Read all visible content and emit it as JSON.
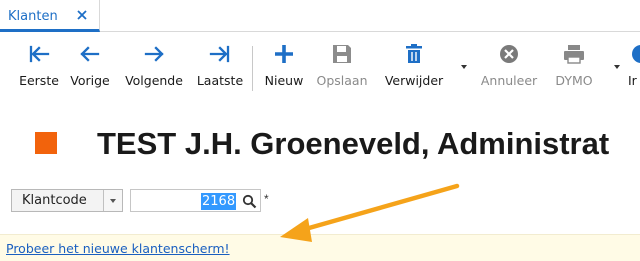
{
  "tab": {
    "label": "Klanten",
    "close_icon": "close-icon"
  },
  "toolbar": {
    "eerste": "Eerste",
    "vorige": "Vorige",
    "volgende": "Volgende",
    "laatste": "Laatste",
    "nieuw": "Nieuw",
    "opslaan": "Opslaan",
    "verwijder": "Verwijder",
    "annuleer": "Annuleer",
    "dymo": "DYMO",
    "partial": "Ir"
  },
  "title": "TEST J.H. Groeneveld, Administrat",
  "search": {
    "field_label": "Klantcode",
    "value": "2168",
    "required_marker": "*"
  },
  "banner": {
    "link_text": "Probeer het nieuwe klantenscherm!"
  },
  "colors": {
    "accent": "#1e6fc6",
    "title_square": "#f2630c",
    "annotation_arrow": "#f5a31a",
    "banner_bg": "#fffbe6"
  }
}
